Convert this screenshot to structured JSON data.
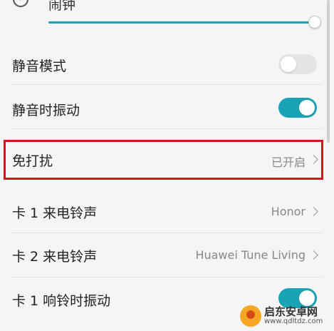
{
  "alarm": {
    "label": "闹钟",
    "volume_fraction": 1.0
  },
  "rows": {
    "silent_mode": {
      "label": "静音模式",
      "toggle_on": false
    },
    "vibrate_silent": {
      "label": "静音时振动",
      "toggle_on": true
    },
    "do_not_disturb": {
      "label": "免打扰",
      "value": "已开启"
    },
    "sim1_ringtone": {
      "label": "卡 1 来电铃声",
      "value": "Honor"
    },
    "sim2_ringtone": {
      "label": "卡 2 来电铃声",
      "value": "Huawei Tune Living"
    },
    "sim1_vibrate_ring": {
      "label": "卡 1 响铃时振动",
      "toggle_on": true
    }
  },
  "highlight_color": "#d4141c",
  "accent_color": "#1aa3b4",
  "watermark": {
    "title": "启东安卓网",
    "url": "www.qdltdz.com"
  }
}
